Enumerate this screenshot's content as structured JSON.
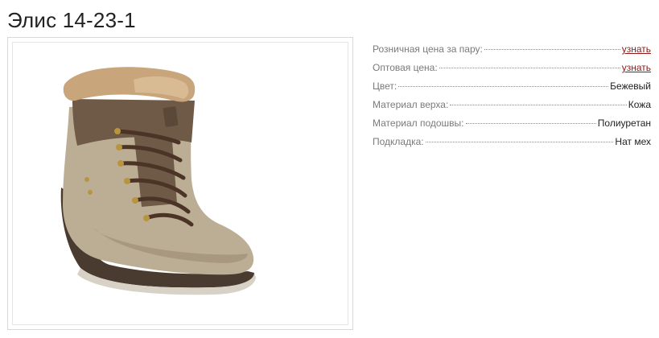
{
  "product": {
    "title": "Элис 14-23-1",
    "image_icon": "ankle-boot-image"
  },
  "specs": [
    {
      "label": "Розничная цена за пару:",
      "value": "узнать",
      "is_link": true
    },
    {
      "label": "Оптовая цена:",
      "value": "узнать",
      "is_link": true
    },
    {
      "label": "Цвет:",
      "value": "Бежевый",
      "is_link": false
    },
    {
      "label": "Материал верха:",
      "value": "Кожа",
      "is_link": false
    },
    {
      "label": "Материал подошвы:",
      "value": "Полиуретан",
      "is_link": false
    },
    {
      "label": "Подкладка:",
      "value": "Нат мех",
      "is_link": false
    }
  ],
  "colors": {
    "link": "#8b1a1a",
    "label": "#7a7a7a",
    "value": "#222222"
  }
}
